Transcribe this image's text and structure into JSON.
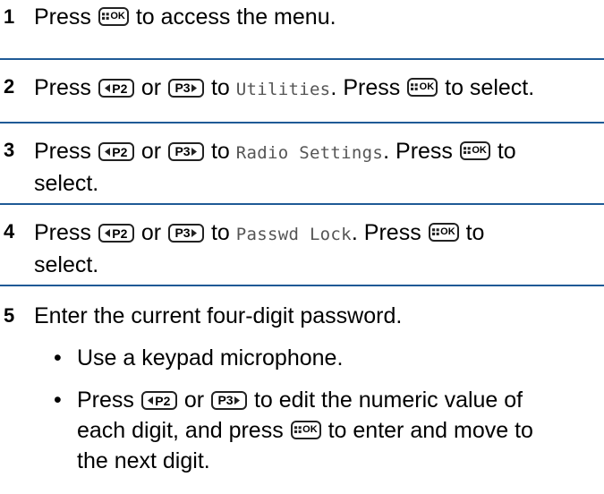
{
  "steps": [
    {
      "num": "1",
      "t1": "Press",
      "t2": "to access the menu."
    },
    {
      "num": "2",
      "t1": "Press",
      "t2": "or",
      "t3": "to",
      "mono": "Utilities",
      "t4": ". Press",
      "t5": "to select."
    },
    {
      "num": "3",
      "t1": "Press",
      "t2": "or",
      "t3": "to",
      "mono": "Radio Settings",
      "t4": ". Press",
      "t5": "to",
      "t6": "select."
    },
    {
      "num": "4",
      "t1": "Press",
      "t2": "or",
      "t3": "to",
      "mono": "Passwd Lock",
      "t4": ". Press",
      "t5": "to",
      "t6": "select."
    },
    {
      "num": "5",
      "text": "Enter the current four-digit password.",
      "b1": "Use a keypad microphone.",
      "b2a": "Press",
      "b2b": "or",
      "b2c": "to edit the numeric value of",
      "b2d": "each digit, and press",
      "b2e": "to enter and move to",
      "b2f": "the next digit."
    }
  ],
  "bullet_char": "•",
  "keys": {
    "ok": "OK",
    "p2": "P2",
    "p3": "P3"
  },
  "separator_color": "#1f5a96"
}
